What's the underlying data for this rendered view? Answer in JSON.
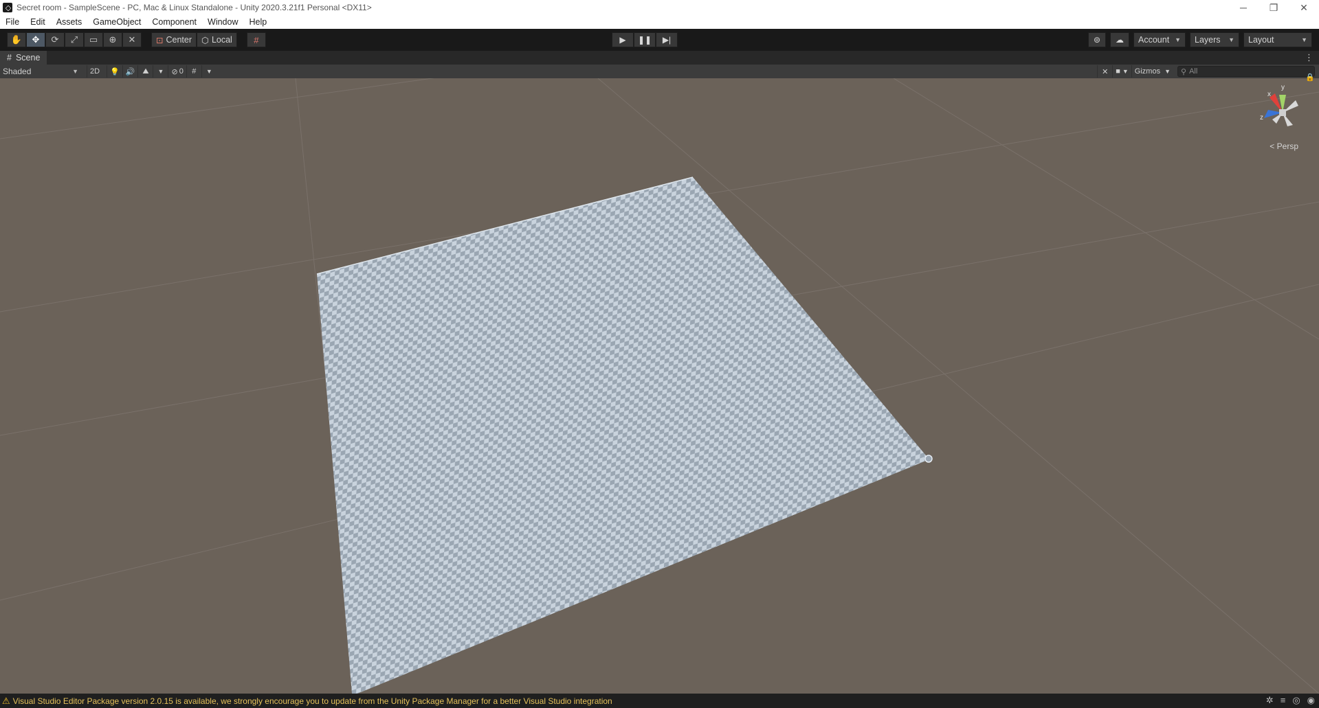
{
  "window": {
    "title": "Secret room - SampleScene - PC, Mac & Linux Standalone - Unity 2020.3.21f1 Personal <DX11>",
    "controls": [
      "─",
      "❐",
      "✕"
    ]
  },
  "menu": [
    "File",
    "Edit",
    "Assets",
    "GameObject",
    "Component",
    "Window",
    "Help"
  ],
  "toolbar": {
    "tools": [
      "hand-icon",
      "move-icon",
      "rotate-icon",
      "scale-icon",
      "rect-icon",
      "transform-icon",
      "custom-tool-icon"
    ],
    "pivot_label": "Center",
    "rotation_label": "Local",
    "account_label": "Account",
    "layers_label": "Layers",
    "layout_label": "Layout"
  },
  "scene_tab": {
    "label": "Scene"
  },
  "scene_toolbar": {
    "shading_mode": "Shaded",
    "mode_2d": "2D",
    "hidden_count": "0",
    "gizmos_label": "Gizmos",
    "search_placeholder": "All"
  },
  "scene_view": {
    "projection_label": "Persp",
    "axis_labels": {
      "x": "x",
      "y": "y",
      "z": "z"
    }
  },
  "status": {
    "message": "Visual Studio Editor Package version 2.0.15 is available, we strongly encourage you to update from the Unity Package Manager for a better Visual Studio integration"
  },
  "colors": {
    "scene_background": "#6b6259",
    "plane_light": "#c9d3dd",
    "plane_dark": "#9aa6b2",
    "warning_text": "#e6c25b"
  }
}
